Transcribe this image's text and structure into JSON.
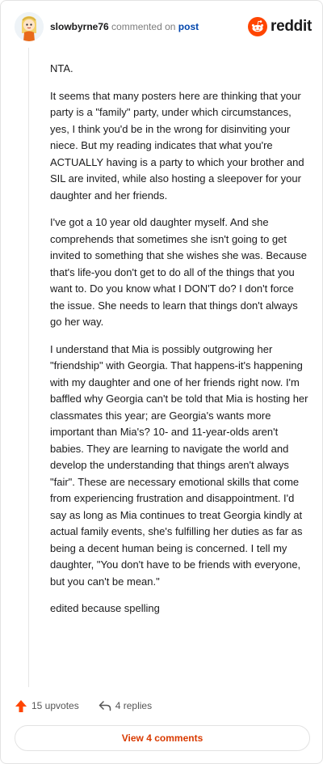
{
  "header": {
    "username": "slowbyrne76",
    "action_text": "commented on",
    "target_link": "post",
    "brand_name": "reddit",
    "brand_color": "#ff4500"
  },
  "comment": {
    "paragraphs": [
      "NTA.",
      "It seems that many posters here are thinking that your party is a \"family\" party, under which circumstances, yes, I think you'd be in the wrong for disinviting your niece. But my reading indicates that what you're ACTUALLY having is a party to which your brother and SIL are invited, while also hosting a sleepover for your daughter and her friends.",
      "I've got a 10 year old daughter myself. And she comprehends that sometimes she isn't going to get invited to something that she wishes she was. Because that's life-you don't get to do all of the things that you want to. Do you know what I DON'T do? I don't force the issue. She needs to learn that things don't always go her way.",
      "I understand that Mia is possibly outgrowing her \"friendship\" with Georgia. That happens-it's happening with my daughter and one of her friends right now. I'm baffled why Georgia can't be told that Mia is hosting her classmates this year; are Georgia's wants more important than Mia's? 10- and 11-year-olds aren't babies. They are learning to navigate the world and develop the understanding that things aren't always \"fair\". These are necessary emotional skills that come from experiencing frustration and disappointment. I'd say as long as Mia continues to treat Georgia kindly at actual family events, she's fulfilling her duties as far as being a decent human being is concerned. I tell my daughter, \"You don't have to be friends with everyone, but you can't be mean.\"",
      "edited because spelling"
    ]
  },
  "actions": {
    "upvotes_label": "15 upvotes",
    "replies_label": "4 replies",
    "upvote_icon": "upvote-arrow-icon",
    "reply_icon": "reply-arrow-icon",
    "upvote_color": "#ff4500"
  },
  "footer": {
    "view_comments_label": "View 4 comments",
    "accent_color": "#d93a00"
  }
}
